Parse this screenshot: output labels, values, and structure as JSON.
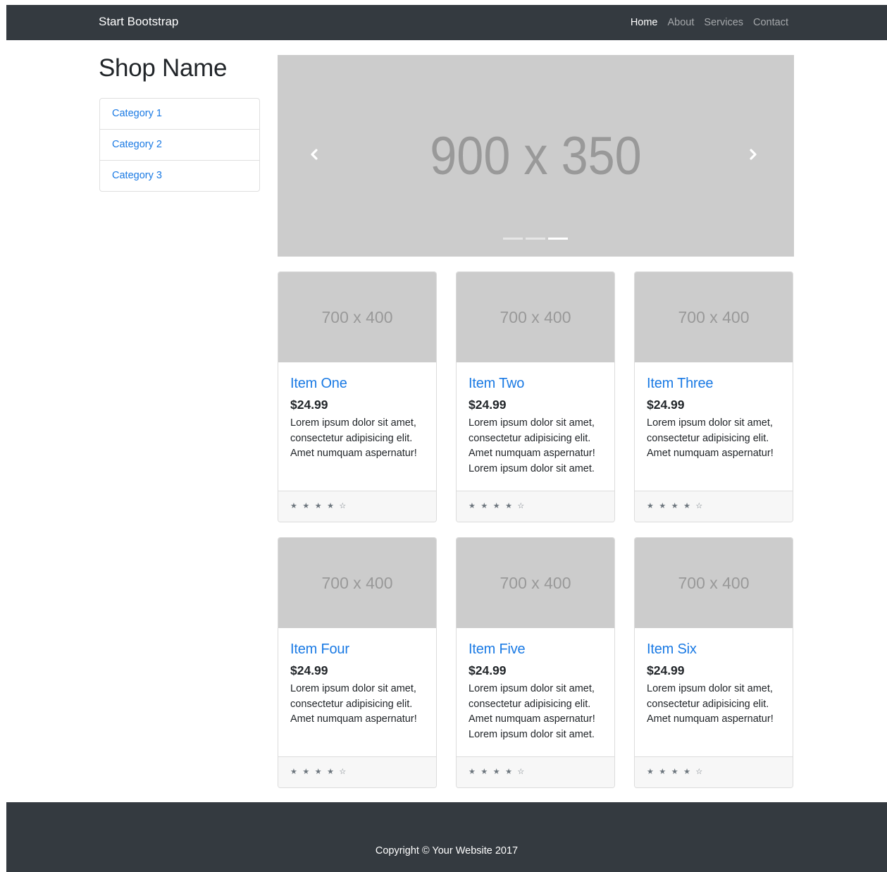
{
  "navbar": {
    "brand": "Start Bootstrap",
    "links": [
      "Home",
      "About",
      "Services",
      "Contact"
    ]
  },
  "sidebar": {
    "shop_name": "Shop Name",
    "categories": [
      "Category 1",
      "Category 2",
      "Category 3"
    ]
  },
  "carousel": {
    "placeholder": "900 x 350",
    "prev_icon": "chevron-left-icon",
    "next_icon": "chevron-right-icon",
    "active_slide": 3,
    "slide_count": 3
  },
  "products": [
    {
      "image": "700 x 400",
      "title": "Item One",
      "price": "$24.99",
      "description": "Lorem ipsum dolor sit amet, consectetur adipisicing elit. Amet numquam aspernatur!",
      "rating": "★ ★ ★ ★ ☆"
    },
    {
      "image": "700 x 400",
      "title": "Item Two",
      "price": "$24.99",
      "description": "Lorem ipsum dolor sit amet, consectetur adipisicing elit. Amet numquam aspernatur! Lorem ipsum dolor sit amet.",
      "rating": "★ ★ ★ ★ ☆"
    },
    {
      "image": "700 x 400",
      "title": "Item Three",
      "price": "$24.99",
      "description": "Lorem ipsum dolor sit amet, consectetur adipisicing elit. Amet numquam aspernatur!",
      "rating": "★ ★ ★ ★ ☆"
    },
    {
      "image": "700 x 400",
      "title": "Item Four",
      "price": "$24.99",
      "description": "Lorem ipsum dolor sit amet, consectetur adipisicing elit. Amet numquam aspernatur!",
      "rating": "★ ★ ★ ★ ☆"
    },
    {
      "image": "700 x 400",
      "title": "Item Five",
      "price": "$24.99",
      "description": "Lorem ipsum dolor sit amet, consectetur adipisicing elit. Amet numquam aspernatur! Lorem ipsum dolor sit amet.",
      "rating": "★ ★ ★ ★ ☆"
    },
    {
      "image": "700 x 400",
      "title": "Item Six",
      "price": "$24.99",
      "description": "Lorem ipsum dolor sit amet, consectetur adipisicing elit. Amet numquam aspernatur!",
      "rating": "★ ★ ★ ★ ☆"
    }
  ],
  "footer": {
    "copyright": "Copyright © Your Website 2017"
  },
  "colors": {
    "navbar_bg": "#343a40",
    "link": "#1a7ae4",
    "placeholder_bg": "#cccccc",
    "placeholder_text": "#999999"
  }
}
